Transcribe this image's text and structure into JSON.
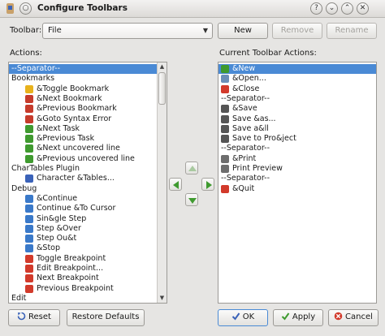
{
  "window": {
    "title": "Configure Toolbars",
    "help_glyph": "?",
    "minimize_glyph": "⌄",
    "maximize_glyph": "⌃",
    "close_glyph": "✕"
  },
  "toolbar_selector": {
    "label": "Toolbar:",
    "value": "File",
    "new_label": "New",
    "remove_label": "Remove",
    "rename_label": "Rename"
  },
  "actions": {
    "label": "Actions:",
    "items": [
      {
        "text": "--Separator--",
        "indent": 0,
        "icon": "none",
        "selected": true
      },
      {
        "text": "Bookmarks",
        "indent": 0,
        "icon": "none"
      },
      {
        "text": "&Toggle Bookmark",
        "indent": 1,
        "icon": "star-icon",
        "color": "#e8b21c"
      },
      {
        "text": "&Next Bookmark",
        "indent": 1,
        "icon": "bookmark-next-icon",
        "color": "#c63b2b"
      },
      {
        "text": "&Previous Bookmark",
        "indent": 1,
        "icon": "bookmark-prev-icon",
        "color": "#c63b2b"
      },
      {
        "text": "&Goto Syntax Error",
        "indent": 1,
        "icon": "goto-error-icon",
        "color": "#c63b2b"
      },
      {
        "text": "&Next Task",
        "indent": 1,
        "icon": "next-task-icon",
        "color": "#3f9a2f"
      },
      {
        "text": "&Previous Task",
        "indent": 1,
        "icon": "prev-task-icon",
        "color": "#3f9a2f"
      },
      {
        "text": "&Next uncovered line",
        "indent": 1,
        "icon": "next-uncovered-icon",
        "color": "#3f9a2f"
      },
      {
        "text": "&Previous uncovered line",
        "indent": 1,
        "icon": "prev-uncovered-icon",
        "color": "#3f9a2f"
      },
      {
        "text": "CharTables Plugin",
        "indent": 0,
        "icon": "none"
      },
      {
        "text": "Character &Tables...",
        "indent": 1,
        "icon": "char-tables-icon",
        "color": "#3a62b8"
      },
      {
        "text": "Debug",
        "indent": 0,
        "icon": "none"
      },
      {
        "text": "&Continue",
        "indent": 1,
        "icon": "continue-icon",
        "color": "#3a79c9"
      },
      {
        "text": "Continue &To Cursor",
        "indent": 1,
        "icon": "continue-cursor-icon",
        "color": "#3a79c9"
      },
      {
        "text": "Sin&gle Step",
        "indent": 1,
        "icon": "single-step-icon",
        "color": "#3a79c9"
      },
      {
        "text": "Step &Over",
        "indent": 1,
        "icon": "step-over-icon",
        "color": "#3a79c9"
      },
      {
        "text": "Step Ou&t",
        "indent": 1,
        "icon": "step-out-icon",
        "color": "#3a79c9"
      },
      {
        "text": "&Stop",
        "indent": 1,
        "icon": "stop-icon",
        "color": "#3a79c9"
      },
      {
        "text": "Toggle Breakpoint",
        "indent": 1,
        "icon": "toggle-breakpoint-icon",
        "color": "#d23a2b"
      },
      {
        "text": "Edit Breakpoint...",
        "indent": 1,
        "icon": "edit-breakpoint-icon",
        "color": "#d23a2b"
      },
      {
        "text": "Next Breakpoint",
        "indent": 1,
        "icon": "next-breakpoint-icon",
        "color": "#d23a2b"
      },
      {
        "text": "Previous Breakpoint",
        "indent": 1,
        "icon": "prev-breakpoint-icon",
        "color": "#d23a2b"
      },
      {
        "text": "Edit",
        "indent": 0,
        "icon": "none"
      }
    ]
  },
  "current_actions": {
    "label": "Current Toolbar Actions:",
    "items": [
      {
        "text": "&New",
        "icon": "new-file-icon",
        "color": "#3f9a2f",
        "selected": true
      },
      {
        "text": "&Open...",
        "icon": "open-icon",
        "color": "#6b8fb8"
      },
      {
        "text": "&Close",
        "icon": "close-file-icon",
        "color": "#d23a2b"
      },
      {
        "text": "--Separator--",
        "icon": "none"
      },
      {
        "text": "&Save",
        "icon": "save-icon",
        "color": "#555555"
      },
      {
        "text": "Save &as...",
        "icon": "save-as-icon",
        "color": "#555555"
      },
      {
        "text": "Save a&ll",
        "icon": "save-all-icon",
        "color": "#555555"
      },
      {
        "text": "Save to Pro&ject",
        "icon": "save-project-icon",
        "color": "#555555"
      },
      {
        "text": "--Separator--",
        "icon": "none"
      },
      {
        "text": "&Print",
        "icon": "print-icon",
        "color": "#6d6d6d"
      },
      {
        "text": "Print Preview",
        "icon": "print-preview-icon",
        "color": "#6d6d6d"
      },
      {
        "text": "--Separator--",
        "icon": "none"
      },
      {
        "text": "&Quit",
        "icon": "quit-icon",
        "color": "#d23a2b"
      }
    ]
  },
  "footer": {
    "reset_label": "Reset",
    "restore_label": "Restore Defaults",
    "ok_label": "OK",
    "apply_label": "Apply",
    "cancel_label": "Cancel"
  },
  "colors": {
    "selection": "#4a8ad5",
    "move_arrow": "#3f9a2f",
    "move_arrow_disabled": "#a9c9a0"
  }
}
